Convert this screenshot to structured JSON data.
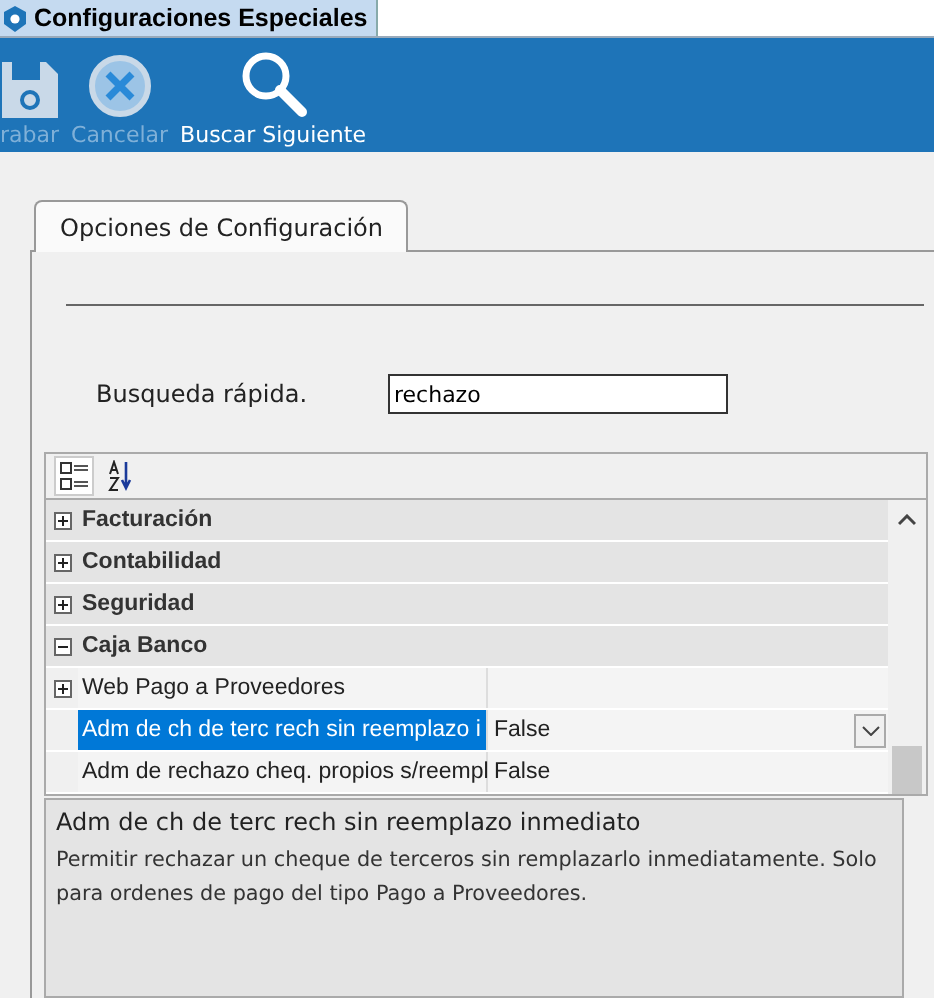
{
  "window": {
    "title": "Configuraciones Especiales"
  },
  "toolbar": [
    {
      "kind": "save",
      "label": "rabar",
      "enabled": false
    },
    {
      "kind": "cancel",
      "label": "Cancelar",
      "enabled": false
    },
    {
      "kind": "search",
      "label": "Buscar Siguiente",
      "enabled": true
    }
  ],
  "tabs": [
    {
      "label": "Opciones de Configuración",
      "selected": true
    }
  ],
  "quick_search": {
    "label": "Busqueda rápida.",
    "value": "rechazo"
  },
  "property_grid": {
    "rows": [
      {
        "kind": "category",
        "name": "Facturación",
        "expanded": false
      },
      {
        "kind": "category",
        "name": "Contabilidad",
        "expanded": false
      },
      {
        "kind": "category",
        "name": "Seguridad",
        "expanded": false
      },
      {
        "kind": "category",
        "name": "Caja Banco",
        "expanded": true
      },
      {
        "kind": "group",
        "name": "Web Pago a Proveedores",
        "expanded": false
      },
      {
        "kind": "property",
        "name": "Adm de ch de terc rech sin reemplazo i",
        "value": "False",
        "selected": true
      },
      {
        "kind": "property",
        "name": "Adm de rechazo cheq. propios s/reempl",
        "value": "False",
        "selected": false
      }
    ]
  },
  "description": {
    "title": "Adm de ch de terc rech sin reemplazo inmediato",
    "text": "Permitir rechazar un cheque de terceros sin remplazarlo inmediatamente. Solo para ordenes de pago del tipo Pago a Proveedores."
  }
}
